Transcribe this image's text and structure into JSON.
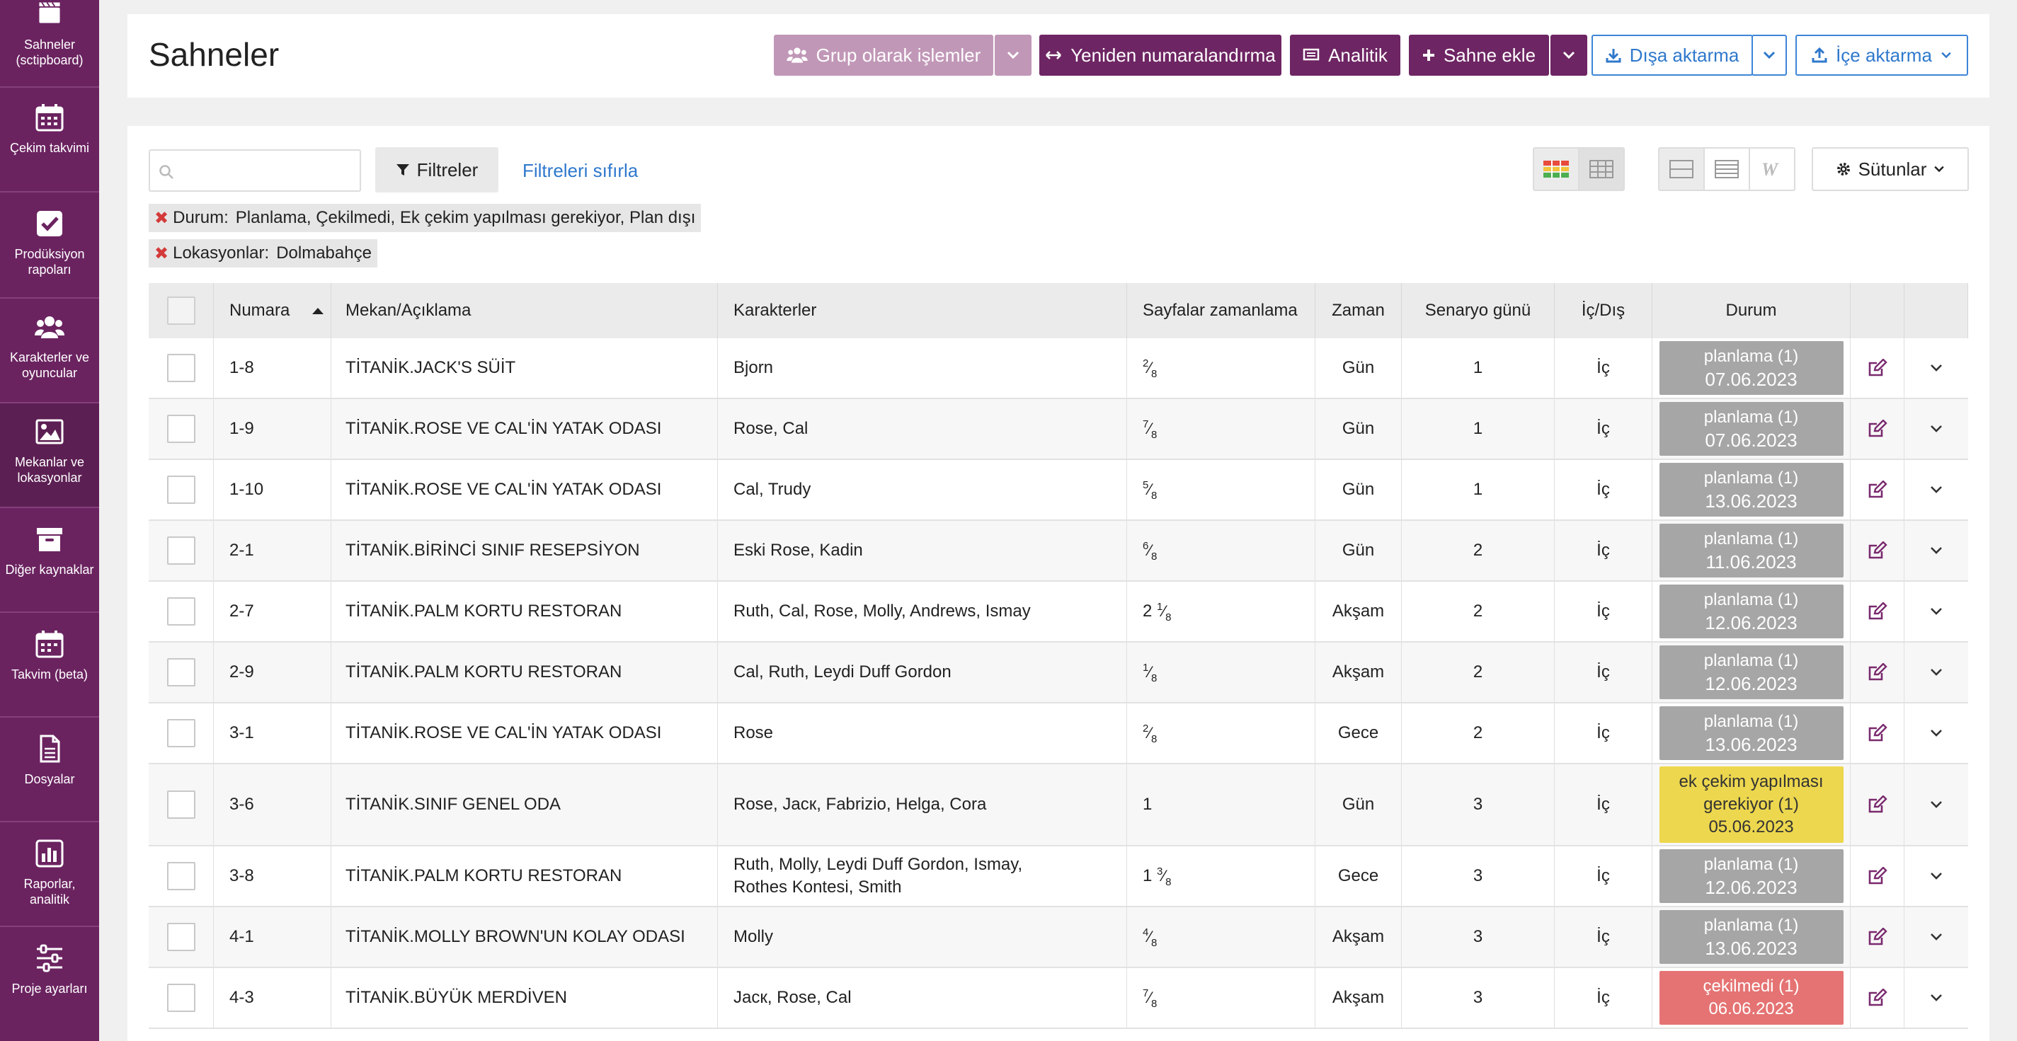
{
  "sidebar": {
    "items": [
      {
        "label": "Sahneler (sctipboard)",
        "icon": "clapperboard-icon"
      },
      {
        "label": "Çekim takvimi",
        "icon": "calendar-icon"
      },
      {
        "label": "Prodüksiyon rapoları",
        "icon": "checkbox-icon"
      },
      {
        "label": "Karakterler ve oyuncular",
        "icon": "users-icon"
      },
      {
        "label": "Mekanlar ve lokasyonlar",
        "icon": "image-icon"
      },
      {
        "label": "Diğer kaynaklar",
        "icon": "archive-icon"
      },
      {
        "label": "Takvim (beta)",
        "icon": "calendar-grid-icon"
      },
      {
        "label": "Dosyalar",
        "icon": "file-icon"
      },
      {
        "label": "Raporlar, analitik",
        "icon": "bar-chart-icon"
      },
      {
        "label": "Proje ayarları",
        "icon": "sliders-icon"
      }
    ]
  },
  "header": {
    "title": "Sahneler",
    "group_actions": "Grup olarak işlemler",
    "renumber": "Yeniden numaralandırma",
    "analytics": "Analitik",
    "add_scene": "Sahne ekle",
    "export": "Dışa aktarma",
    "import": "İçe aktarma"
  },
  "toolbar": {
    "search_placeholder": "",
    "filters": "Filtreler",
    "reset_filters": "Filtreleri sıfırla",
    "columns": "Sütunlar"
  },
  "active_filters": [
    {
      "key": "Durum:",
      "value": "Planlama, Çekilmedi, Ek çekim yapılması gerekiyor, Plan dışı"
    },
    {
      "key": "Lokasyonlar:",
      "value": "Dolmabahçe"
    }
  ],
  "table": {
    "headers": {
      "number": "Numara",
      "location": "Mekan/Açıklama",
      "characters": "Karakterler",
      "pages": "Sayfalar zamanlama",
      "time": "Zaman",
      "script_day": "Senaryo günü",
      "int_ext": "İç/Dış",
      "status": "Durum"
    },
    "rows": [
      {
        "num": "1-8",
        "loc": "TİTANİK.JACK'S SÜİT",
        "chars": "Bjorn",
        "whole": "",
        "n": "2",
        "d": "8",
        "time": "Gün",
        "day": "1",
        "io": "İç",
        "status": "planlama (1)",
        "date": "07.06.2023",
        "kind": "plan"
      },
      {
        "num": "1-9",
        "loc": "TİTANİK.ROSE VE CAL'İN YATAK ODASI",
        "chars": "Rose, Cal",
        "whole": "",
        "n": "7",
        "d": "8",
        "time": "Gün",
        "day": "1",
        "io": "İç",
        "status": "planlama (1)",
        "date": "07.06.2023",
        "kind": "plan"
      },
      {
        "num": "1-10",
        "loc": "TİTANİK.ROSE VE CAL'İN YATAK ODASI",
        "chars": "Cal, Trudy",
        "whole": "",
        "n": "5",
        "d": "8",
        "time": "Gün",
        "day": "1",
        "io": "İç",
        "status": "planlama (1)",
        "date": "13.06.2023",
        "kind": "plan"
      },
      {
        "num": "2-1",
        "loc": "TİTANİK.BİRİNCİ SINIF RESEPSİYON",
        "chars": "Eski Rose, Kadin",
        "whole": "",
        "n": "6",
        "d": "8",
        "time": "Gün",
        "day": "2",
        "io": "İç",
        "status": "planlama (1)",
        "date": "11.06.2023",
        "kind": "plan"
      },
      {
        "num": "2-7",
        "loc": "TİTANİK.PALM KORTU RESTORAN",
        "chars": "Ruth, Cal, Rose, Molly, Andrews, Ismay",
        "whole": "2",
        "n": "1",
        "d": "8",
        "time": "Akşam",
        "day": "2",
        "io": "İç",
        "status": "planlama (1)",
        "date": "12.06.2023",
        "kind": "plan"
      },
      {
        "num": "2-9",
        "loc": "TİTANİK.PALM KORTU RESTORAN",
        "chars": "Cal, Ruth, Leydi Duff Gordon",
        "whole": "",
        "n": "1",
        "d": "8",
        "time": "Akşam",
        "day": "2",
        "io": "İç",
        "status": "planlama (1)",
        "date": "12.06.2023",
        "kind": "plan"
      },
      {
        "num": "3-1",
        "loc": "TİTANİK.ROSE VE CAL'İN YATAK ODASI",
        "chars": "Rose",
        "whole": "",
        "n": "2",
        "d": "8",
        "time": "Gece",
        "day": "2",
        "io": "İç",
        "status": "planlama (1)",
        "date": "13.06.2023",
        "kind": "plan"
      },
      {
        "num": "3-6",
        "loc": "TİTANİK.SINIF GENEL ODA",
        "chars": "Rose, Jacк, Fabrizio, Helga, Cora",
        "whole": "1",
        "n": "",
        "d": "",
        "time": "Gün",
        "day": "3",
        "io": "İç",
        "status": "ek çekim yapılması gerekiyor (1)",
        "date": "05.06.2023",
        "kind": "yellow"
      },
      {
        "num": "3-8",
        "loc": "TİTANİK.PALM KORTU RESTORAN",
        "chars": "Ruth, Molly, Leydi Duff Gordon, Ismay, Rothes Kontesi, Smith",
        "whole": "1",
        "n": "3",
        "d": "8",
        "time": "Gece",
        "day": "3",
        "io": "İç",
        "status": "planlama (1)",
        "date": "12.06.2023",
        "kind": "plan"
      },
      {
        "num": "4-1",
        "loc": "TİTANİK.MOLLY BROWN'UN KOLAY ODASI",
        "chars": "Molly",
        "whole": "",
        "n": "4",
        "d": "8",
        "time": "Akşam",
        "day": "3",
        "io": "İç",
        "status": "planlama (1)",
        "date": "13.06.2023",
        "kind": "plan"
      },
      {
        "num": "4-3",
        "loc": "TİTANİK.BÜYÜK MERDİVEN",
        "chars": "Jacк, Rose, Cal",
        "whole": "",
        "n": "7",
        "d": "8",
        "time": "Akşam",
        "day": "3",
        "io": "İç",
        "status": "çekilmedi (1)",
        "date": "06.06.2023",
        "kind": "red"
      }
    ]
  },
  "colors": {
    "sidebar_bg": "#6b2360",
    "primary": "#6e2563",
    "primary_disabled": "#c197b7",
    "link": "#2f78cc",
    "status_plan": "#a6a6a6",
    "status_reshoot": "#edd74e",
    "status_not_shot": "#e57373"
  }
}
